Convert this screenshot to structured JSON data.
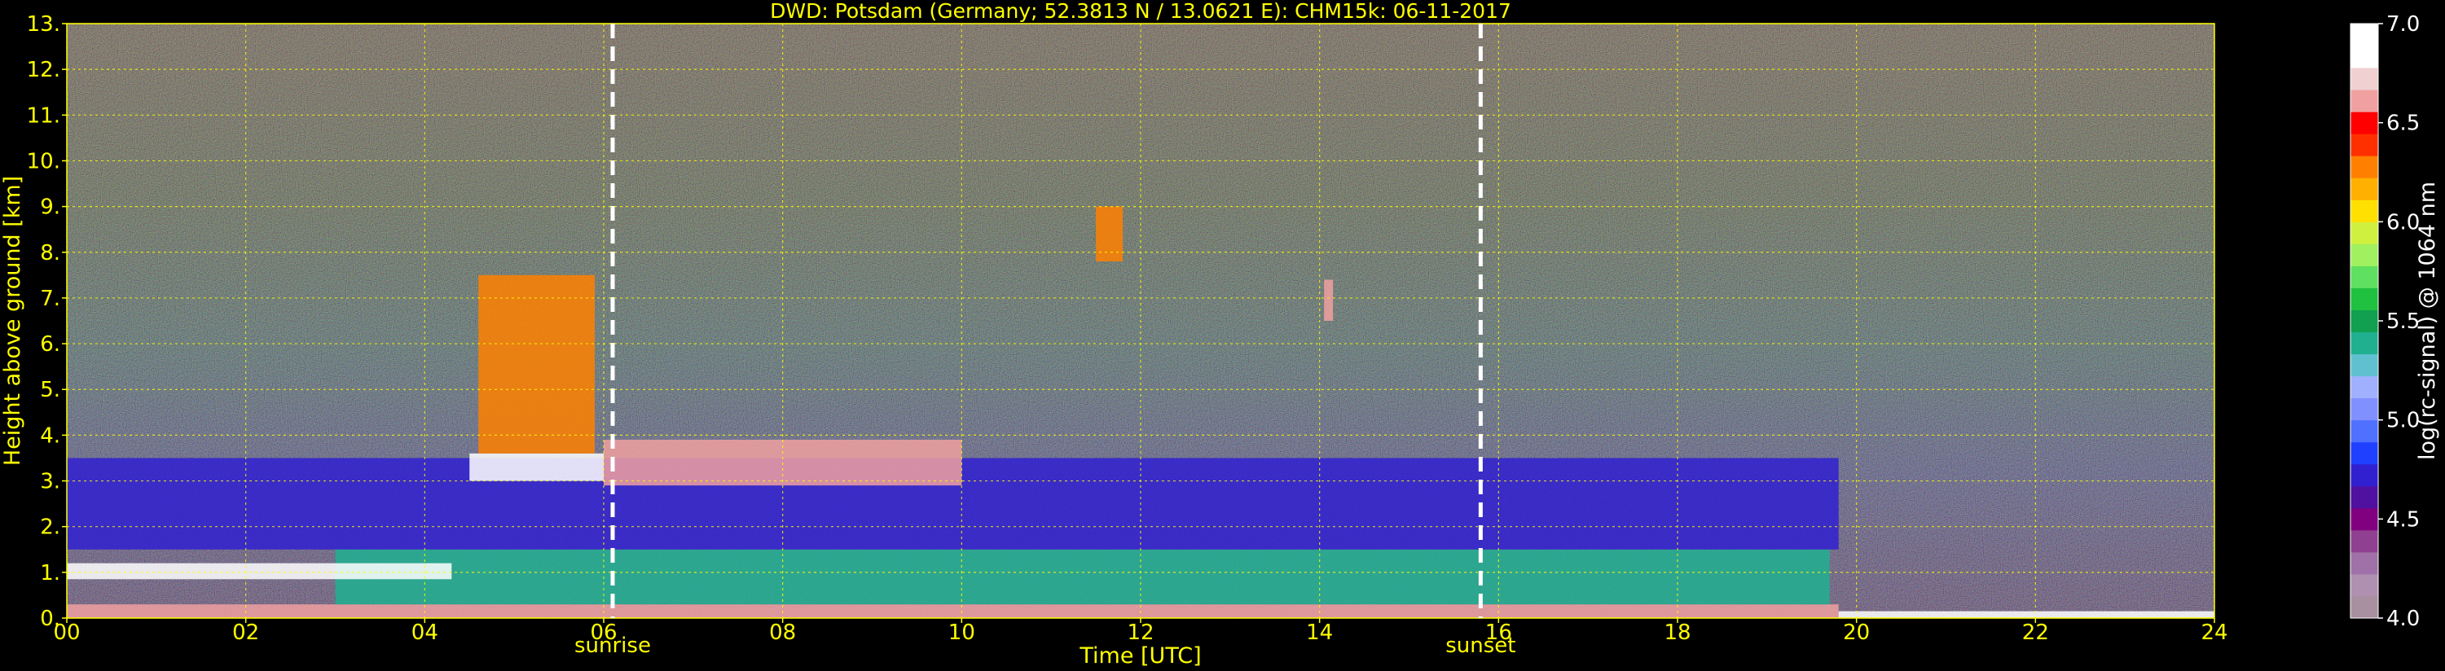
{
  "chart_data": {
    "type": "heatmap",
    "title": "DWD: Potsdam (Germany; 52.3813 N / 13.0621 E):    CHM15k: 06-11-2017",
    "xlabel": "Time [UTC]",
    "ylabel": "Height above ground [km]",
    "xlim": [
      0,
      24
    ],
    "ylim": [
      0,
      13
    ],
    "x_ticks": [
      "00",
      "02",
      "04",
      "06",
      "08",
      "10",
      "12",
      "14",
      "16",
      "18",
      "20",
      "22",
      "24"
    ],
    "y_ticks": [
      "0.",
      "1.",
      "2.",
      "3.",
      "4.",
      "5.",
      "6.",
      "7.",
      "8.",
      "9.",
      "10.",
      "11.",
      "12.",
      "13."
    ],
    "grid": true,
    "annotations": [
      {
        "label": "sunrise",
        "x": 6.1
      },
      {
        "label": "sunset",
        "x": 15.8
      }
    ],
    "colorbar": {
      "label": "log(rc-signal) @ 1064 nm",
      "range": [
        4.0,
        7.0
      ],
      "ticks": [
        "4.0",
        "4.5",
        "5.0",
        "5.5",
        "6.0",
        "6.5",
        "7.0"
      ],
      "colors": [
        "#a890a0",
        "#b090b0",
        "#a070a8",
        "#904090",
        "#800080",
        "#5010a0",
        "#3020d0",
        "#2040ff",
        "#5070ff",
        "#8090ff",
        "#a0b0ff",
        "#60c0d0",
        "#20b090",
        "#10a050",
        "#20c040",
        "#60e060",
        "#a0f060",
        "#d0f040",
        "#ffe000",
        "#ffb000",
        "#ff8000",
        "#ff3000",
        "#ff0000",
        "#f0a0a0",
        "#f0d0d0",
        "#ffffff",
        "#ffffff"
      ]
    },
    "features": [
      {
        "name": "surface layer",
        "t0": 0,
        "t1": 19.8,
        "h0": 0,
        "h1": 0.3,
        "level": 6.6
      },
      {
        "name": "boundary layer",
        "t0": 3,
        "t1": 19.7,
        "h0": 0.3,
        "h1": 1.5,
        "level": 5.4
      },
      {
        "name": "residual layer",
        "t0": 0,
        "t1": 19.8,
        "h0": 1.5,
        "h1": 3.5,
        "level": 4.7
      },
      {
        "name": "cloud",
        "t0": 0,
        "t1": 4.3,
        "h0": 0.85,
        "h1": 1.2,
        "level": 7.0
      },
      {
        "name": "cloud",
        "t0": 4.5,
        "t1": 6.0,
        "h0": 3.0,
        "h1": 3.6,
        "level": 7.0
      },
      {
        "name": "cloud",
        "t0": 4.6,
        "t1": 5.9,
        "h0": 3.6,
        "h1": 7.5,
        "level": 6.3
      },
      {
        "name": "cloud",
        "t0": 6.0,
        "t1": 10.0,
        "h0": 2.9,
        "h1": 3.9,
        "level": 6.6
      },
      {
        "name": "cloud",
        "t0": 11.5,
        "t1": 11.8,
        "h0": 7.8,
        "h1": 9.0,
        "level": 6.3
      },
      {
        "name": "cloud",
        "t0": 14.05,
        "t1": 14.15,
        "h0": 6.5,
        "h1": 7.4,
        "level": 6.6
      },
      {
        "name": "cloud",
        "t0": 19.8,
        "t1": 24,
        "h0": 0.0,
        "h1": 0.15,
        "level": 7.0
      }
    ]
  }
}
